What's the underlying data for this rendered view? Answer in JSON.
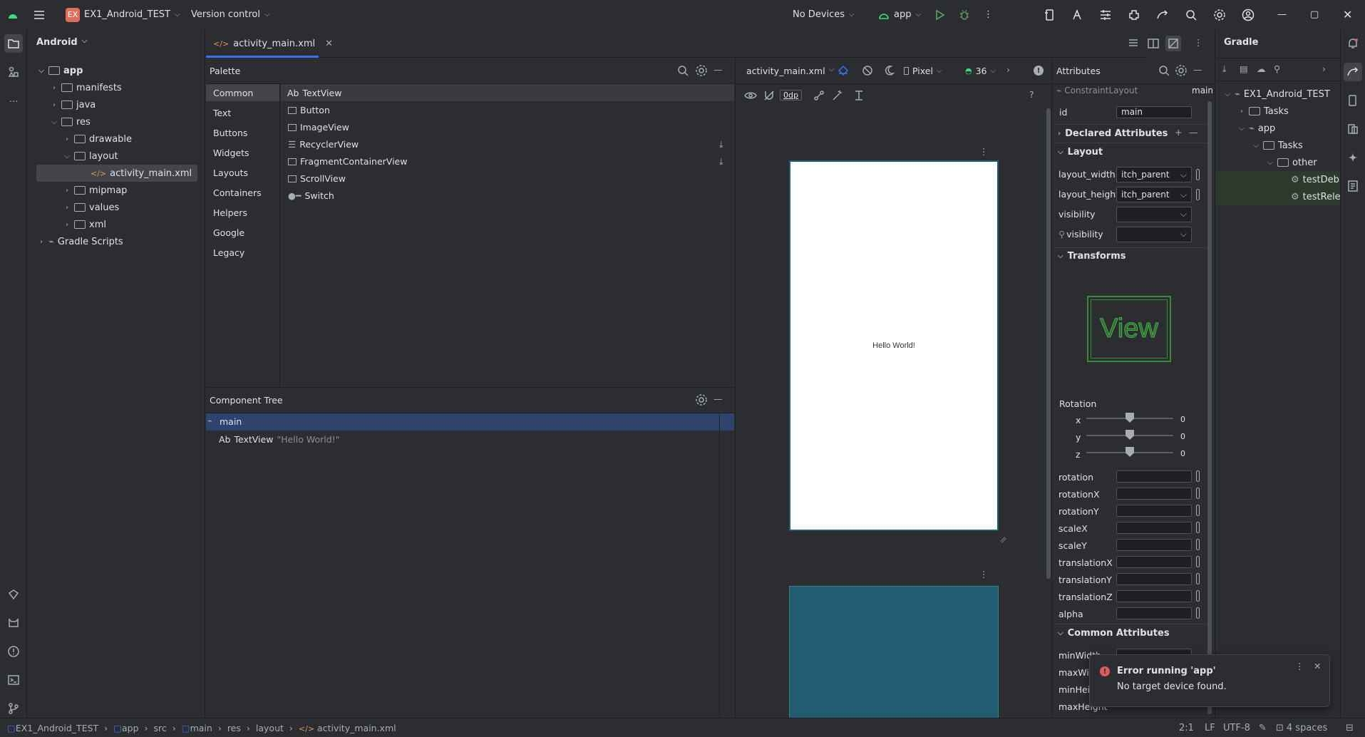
{
  "titlebar": {
    "project_badge": "EX",
    "project_name": "EX1_Android_TEST",
    "vcs": "Version control",
    "device": "No Devices",
    "run_config": "app"
  },
  "left_panel": {
    "title": "Android",
    "tree": [
      {
        "label": "app"
      },
      {
        "label": "manifests"
      },
      {
        "label": "java"
      },
      {
        "label": "res"
      },
      {
        "label": "drawable"
      },
      {
        "label": "layout"
      },
      {
        "label": "activity_main.xml"
      },
      {
        "label": "mipmap"
      },
      {
        "label": "values"
      },
      {
        "label": "xml"
      },
      {
        "label": "Gradle Scripts"
      }
    ]
  },
  "editor": {
    "tab_label": "activity_main.xml"
  },
  "palette": {
    "title": "Palette",
    "categories": [
      "Common",
      "Text",
      "Buttons",
      "Widgets",
      "Layouts",
      "Containers",
      "Helpers",
      "Google",
      "Legacy"
    ],
    "items": [
      {
        "icon": "Ab",
        "label": "TextView"
      },
      {
        "icon": "",
        "label": "Button"
      },
      {
        "icon": "",
        "label": "ImageView"
      },
      {
        "icon": "",
        "label": "RecyclerView"
      },
      {
        "icon": "",
        "label": "FragmentContainerView"
      },
      {
        "icon": "",
        "label": "ScrollView"
      },
      {
        "icon": "",
        "label": "Switch"
      }
    ]
  },
  "component_tree": {
    "title": "Component Tree",
    "root": "main",
    "child_prefix": "Ab",
    "child": "TextView",
    "child_text": "\"Hello World!\""
  },
  "design_toolbar": {
    "file": "activity_main.xml",
    "device": "Pixel",
    "api": "36",
    "margin": "0dp"
  },
  "canvas": {
    "hello": "Hello World!"
  },
  "attributes": {
    "title": "Attributes",
    "class_name": "ConstraintLayout",
    "class_id": "main",
    "id_label": "id",
    "id_value": "main",
    "declared": "Declared Attributes",
    "layout": "Layout",
    "layout_width_label": "layout_width",
    "layout_width": "itch_parent",
    "layout_height_label": "layout_height",
    "layout_height": "itch_parent",
    "visibility_label": "visibility",
    "tools_visibility_label": "visibility",
    "transforms": "Transforms",
    "view_preview": "View",
    "rotation_title": "Rotation",
    "rot_axes": [
      {
        "axis": "x",
        "value": "0"
      },
      {
        "axis": "y",
        "value": "0"
      },
      {
        "axis": "z",
        "value": "0"
      }
    ],
    "props": [
      "rotation",
      "rotationX",
      "rotationY",
      "scaleX",
      "scaleY",
      "translationX",
      "translationY",
      "translationZ",
      "alpha"
    ],
    "common": "Common Attributes",
    "common_props": [
      "minWidth",
      "maxWid",
      "minHeig",
      "maxHeight"
    ]
  },
  "gradle": {
    "title": "Gradle",
    "tree": [
      {
        "label": "EX1_Android_TEST"
      },
      {
        "label": "Tasks"
      },
      {
        "label": "app"
      },
      {
        "label": "Tasks"
      },
      {
        "label": "other"
      },
      {
        "label": "testDebu"
      },
      {
        "label": "testRele"
      }
    ]
  },
  "notification": {
    "title": "Error running 'app'",
    "message": "No target device found."
  },
  "statusbar": {
    "crumbs": [
      "EX1_Android_TEST",
      "app",
      "src",
      "main",
      "res",
      "layout",
      "activity_main.xml"
    ],
    "position": "2:1",
    "line_sep": "LF",
    "encoding": "UTF-8",
    "indent": "4 spaces"
  },
  "colors": {
    "accent": "#3574f0",
    "selection": "#2e436e",
    "android_green": "#3ddc84",
    "canvas_blueprint": "#225c70",
    "error": "#db5c5c"
  }
}
